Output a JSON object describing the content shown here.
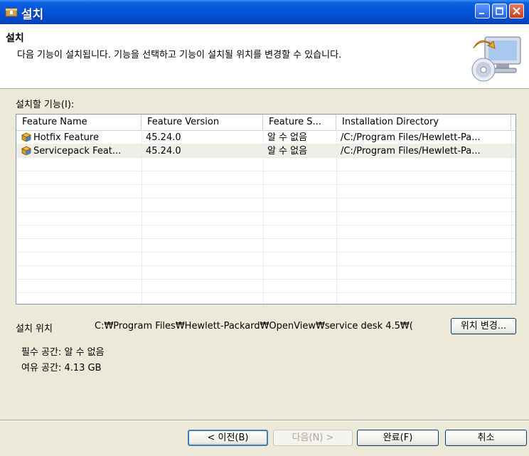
{
  "window": {
    "title": "설치",
    "icons": {
      "app": "installer-package-icon",
      "minimize": "minimize-icon",
      "maximize": "maximize-icon",
      "close": "close-icon"
    }
  },
  "banner": {
    "title": "설치",
    "description": "다음 기능이 설치됩니다. 기능을 선택하고 기능이 설치될 위치를 변경할 수 있습니다.",
    "icon": "install-cd-computer-icon"
  },
  "features": {
    "label": "설치할 기능(I):",
    "columns": [
      "Feature Name",
      "Feature Version",
      "Feature S...",
      "Installation Directory"
    ],
    "rows": [
      {
        "name": "Hotfix Feature",
        "version": "45.24.0",
        "status": "알 수 없음",
        "dir": "/C:/Program Files/Hewlett-Pa...",
        "icon": "feature-package-icon"
      },
      {
        "name": "Servicepack Feat...",
        "version": "45.24.0",
        "status": "알 수 없음",
        "dir": "/C:/Program Files/Hewlett-Pa...",
        "icon": "feature-package-icon"
      }
    ]
  },
  "location": {
    "label": "설치 위치",
    "path": "C:₩Program Files₩Hewlett-Packard₩OpenView₩service desk 4.5₩(",
    "change_button": "위치 변경..."
  },
  "space": {
    "required": "필수 공간: 알 수 없음",
    "free": "여유 공간: 4.13 GB"
  },
  "buttons": {
    "back": "< 이전(B)",
    "next": "다음(N) >",
    "finish": "완료(F)",
    "cancel": "취소"
  },
  "colors": {
    "titlebar": "#0454d8",
    "dialog_bg": "#ece9d8",
    "selected_row": "#f0efe7"
  }
}
